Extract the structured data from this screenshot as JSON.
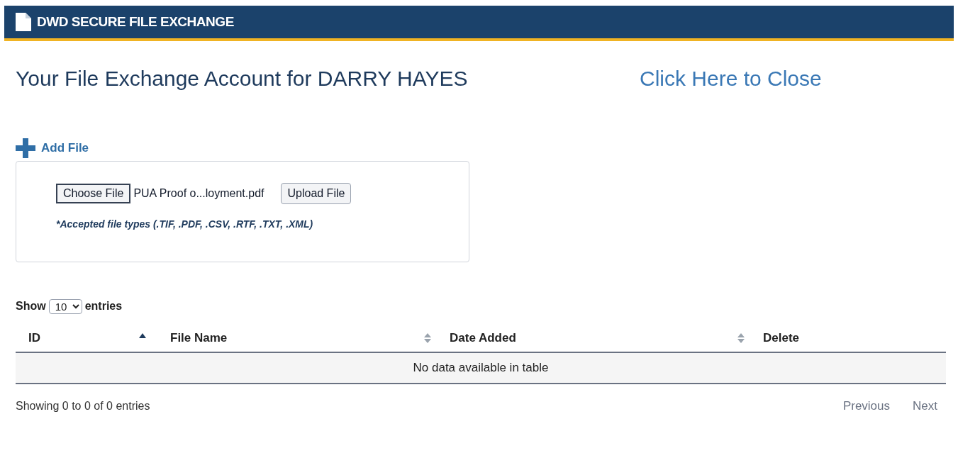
{
  "header": {
    "title": "DWD SECURE FILE EXCHANGE"
  },
  "page_title": "Your File Exchange Account for DARRY HAYES",
  "close_link": "Click Here to Close",
  "add_file": {
    "label": "Add File",
    "choose_button": "Choose File",
    "file_name": "PUA Proof o...loyment.pdf",
    "upload_button": "Upload File",
    "note": "*Accepted file types (.TIF, .PDF, .CSV, .RTF, .TXT, .XML)"
  },
  "length": {
    "before": "Show",
    "value": "10",
    "after": "entries"
  },
  "table": {
    "columns": [
      {
        "label": "ID",
        "sortable": true,
        "sorted": true
      },
      {
        "label": "File Name",
        "sortable": true,
        "sorted": false
      },
      {
        "label": "Date Added",
        "sortable": true,
        "sorted": false
      },
      {
        "label": "Delete",
        "sortable": false
      }
    ],
    "empty": "No data available in table"
  },
  "info": "Showing 0 to 0 of 0 entries",
  "pager": [
    {
      "label": "Previous",
      "disabled": true
    },
    {
      "label": "Next",
      "disabled": true
    }
  ]
}
